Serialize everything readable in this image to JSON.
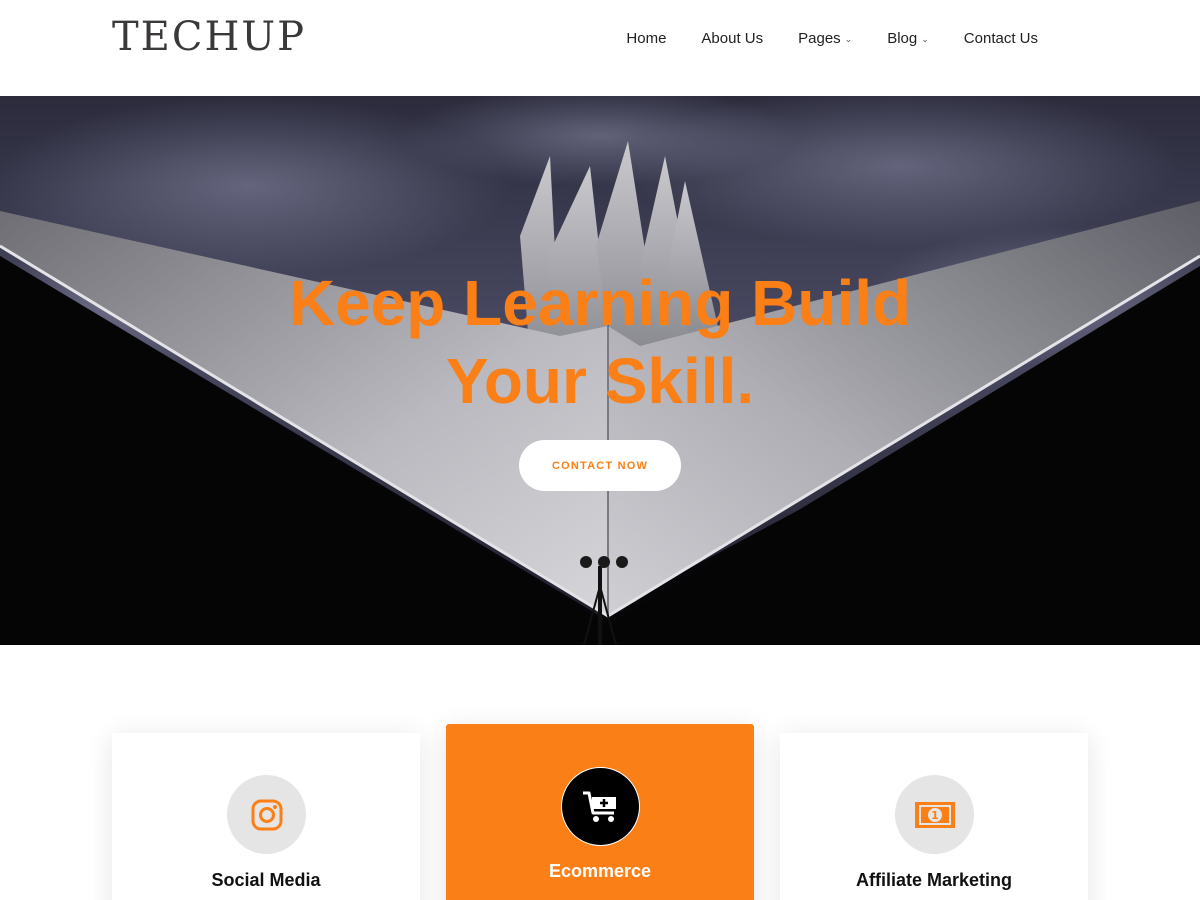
{
  "header": {
    "logo": "TECHUP",
    "nav": [
      {
        "label": "Home",
        "has_dropdown": false
      },
      {
        "label": "About Us",
        "has_dropdown": false
      },
      {
        "label": "Pages",
        "has_dropdown": true
      },
      {
        "label": "Blog",
        "has_dropdown": true
      },
      {
        "label": "Contact Us",
        "has_dropdown": false
      }
    ]
  },
  "hero": {
    "title_line1": "Keep Learning Build",
    "title_line2": "Your Skill.",
    "button_label": "CONTACT NOW",
    "background_image": "tent-shaped-building-under-stormy-sky"
  },
  "features": [
    {
      "title": "Social Media",
      "icon": "instagram-icon",
      "highlighted": false
    },
    {
      "title": "Ecommerce",
      "icon": "cart-plus-icon",
      "highlighted": true
    },
    {
      "title": "Affiliate Marketing",
      "icon": "money-bill-icon",
      "highlighted": false
    }
  ],
  "colors": {
    "accent": "#fa7f16",
    "logo": "#3b3838",
    "text": "#222222",
    "icon_bg": "#e5e5e5"
  }
}
